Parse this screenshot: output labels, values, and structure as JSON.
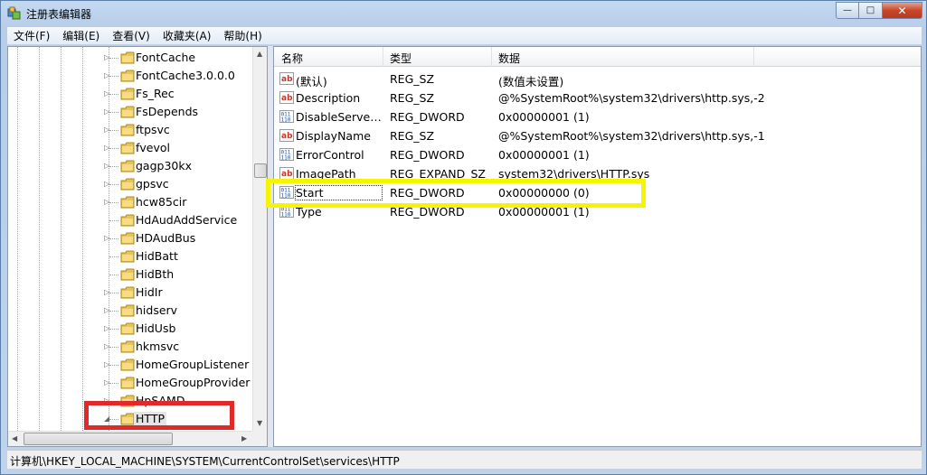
{
  "window": {
    "title": "注册表编辑器",
    "icon": "regedit-icon",
    "controls": {
      "minimize": "—",
      "maximize": "□",
      "close": "✕"
    }
  },
  "menu": [
    "文件(F)",
    "编辑(E)",
    "查看(V)",
    "收藏夹(A)",
    "帮助(H)"
  ],
  "tree": {
    "items": [
      {
        "label": "FontCache",
        "expandable": true
      },
      {
        "label": "FontCache3.0.0.0",
        "expandable": true
      },
      {
        "label": "Fs_Rec",
        "expandable": true
      },
      {
        "label": "FsDepends",
        "expandable": true
      },
      {
        "label": "ftpsvc",
        "expandable": true
      },
      {
        "label": "fvevol",
        "expandable": true
      },
      {
        "label": "gagp30kx",
        "expandable": true
      },
      {
        "label": "gpsvc",
        "expandable": true
      },
      {
        "label": "hcw85cir",
        "expandable": true
      },
      {
        "label": "HdAudAddService",
        "expandable": false
      },
      {
        "label": "HDAudBus",
        "expandable": true
      },
      {
        "label": "HidBatt",
        "expandable": false
      },
      {
        "label": "HidBth",
        "expandable": false
      },
      {
        "label": "HidIr",
        "expandable": true
      },
      {
        "label": "hidserv",
        "expandable": true
      },
      {
        "label": "HidUsb",
        "expandable": true
      },
      {
        "label": "hkmsvc",
        "expandable": true
      },
      {
        "label": "HomeGroupListener",
        "expandable": true
      },
      {
        "label": "HomeGroupProvider",
        "expandable": true
      },
      {
        "label": "HpSAMD",
        "expandable": true
      },
      {
        "label": "HTTP",
        "expandable": true,
        "expanded": true,
        "selected": true
      }
    ]
  },
  "list": {
    "columns": [
      "名称",
      "类型",
      "数据"
    ],
    "rows": [
      {
        "icon": "string-value-icon",
        "name": "(默认)",
        "type": "REG_SZ",
        "data": "(数值未设置)"
      },
      {
        "icon": "string-value-icon",
        "name": "Description",
        "type": "REG_SZ",
        "data": "@%SystemRoot%\\system32\\drivers\\http.sys,-2"
      },
      {
        "icon": "binary-value-icon",
        "name": "DisableServer...",
        "type": "REG_DWORD",
        "data": "0x00000001 (1)"
      },
      {
        "icon": "string-value-icon",
        "name": "DisplayName",
        "type": "REG_SZ",
        "data": "@%SystemRoot%\\system32\\drivers\\http.sys,-1"
      },
      {
        "icon": "binary-value-icon",
        "name": "ErrorControl",
        "type": "REG_DWORD",
        "data": "0x00000001 (1)"
      },
      {
        "icon": "string-value-icon",
        "name": "ImagePath",
        "type": "REG_EXPAND_SZ",
        "data": "system32\\drivers\\HTTP.sys"
      },
      {
        "icon": "binary-value-icon",
        "name": "Start",
        "type": "REG_DWORD",
        "data": "0x00000000 (0)",
        "focused": true
      },
      {
        "icon": "binary-value-icon",
        "name": "Type",
        "type": "REG_DWORD",
        "data": "0x00000001 (1)"
      }
    ]
  },
  "status": "计算机\\HKEY_LOCAL_MACHINE\\SYSTEM\\CurrentControlSet\\services\\HTTP",
  "annotations": {
    "yellow": "#f5f500",
    "red": "#e02a2a"
  }
}
